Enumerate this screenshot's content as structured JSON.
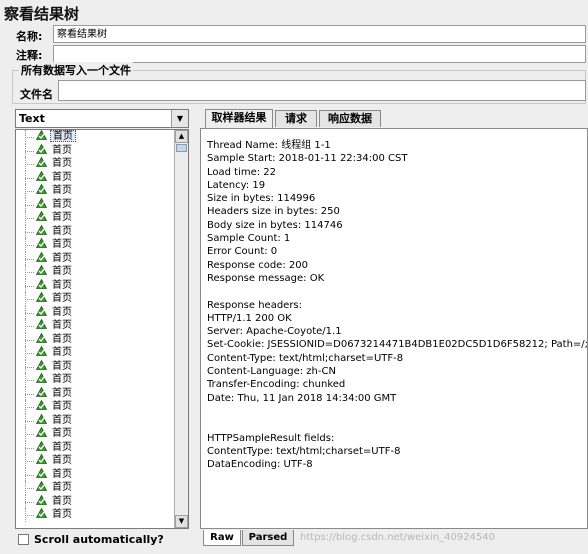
{
  "header": {
    "title": "察看结果树"
  },
  "form": {
    "name_label": "名称:",
    "name_value": "察看结果树",
    "comment_label": "注释:",
    "comment_value": "",
    "group_title": "所有数据写入一个文件",
    "file_label": "文件名",
    "file_value": ""
  },
  "left_panel": {
    "renderer_value": "Text",
    "scroll_auto_label": "Scroll automatically?",
    "tree_item_label": "首页",
    "tree_item_count": 29,
    "selected_index": 0
  },
  "tabs": {
    "sampler_result": "取样器结果",
    "request": "请求",
    "response_data": "响应数据"
  },
  "result_lines": [
    "Thread Name: 线程组 1-1",
    "Sample Start: 2018-01-11 22:34:00 CST",
    "Load time: 22",
    "Latency: 19",
    "Size in bytes: 114996",
    "Headers size in bytes: 250",
    "Body size in bytes: 114746",
    "Sample Count: 1",
    "Error Count: 0",
    "Response code: 200",
    "Response message: OK",
    "",
    "Response headers:",
    "HTTP/1.1 200 OK",
    "Server: Apache-Coyote/1.1",
    "Set-Cookie: JSESSIONID=D0673214471B4DB1E02DC5D1D6F58212; Path=/; H",
    "Content-Type: text/html;charset=UTF-8",
    "Content-Language: zh-CN",
    "Transfer-Encoding: chunked",
    "Date: Thu, 11 Jan 2018 14:34:00 GMT",
    "",
    "",
    "HTTPSampleResult fields:",
    "ContentType: text/html;charset=UTF-8",
    "DataEncoding: UTF-8"
  ],
  "bottom_tabs": {
    "raw": "Raw",
    "parsed": "Parsed"
  },
  "watermark": "https://blog.csdn.net/weixin_40924540",
  "colors": {
    "ok_icon": "#3b9a2f",
    "selection": "#dfe8f6"
  }
}
